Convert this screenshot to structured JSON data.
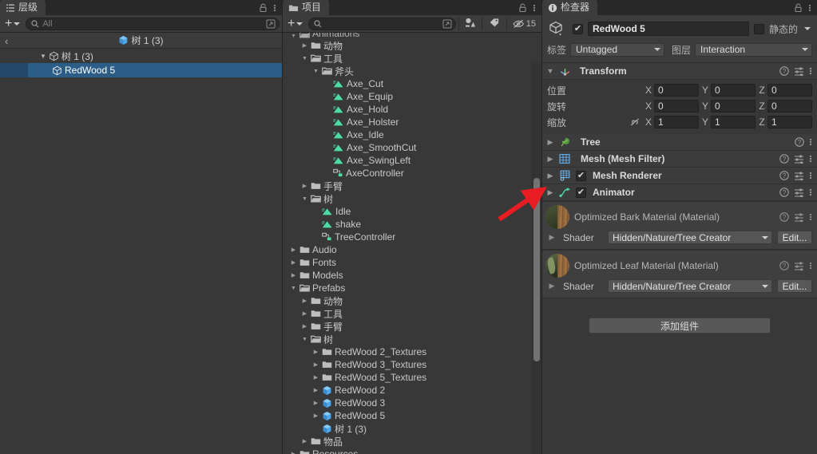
{
  "hierarchy": {
    "tab_label": "层级",
    "tab_icon": "hierarchy-icon",
    "lock_icon": "lock-icon",
    "menu_icon": "kebab-menu-icon",
    "add_label": "+",
    "search_placeholder": "All",
    "breadcrumb": {
      "back": "‹",
      "label": "树 1 (3)"
    },
    "rows": [
      {
        "label": "树 1 (3)",
        "depth": 1,
        "arrow": "▼",
        "icon": "prefab-outline-icon",
        "selected": false
      },
      {
        "label": "RedWood 5",
        "depth": 2,
        "arrow": "",
        "icon": "prefab-outline-icon",
        "selected": true
      }
    ]
  },
  "project": {
    "tab_label": "项目",
    "tab_icon": "folder-icon",
    "lock_icon": "lock-icon",
    "menu_icon": "kebab-menu-icon",
    "add_label": "+",
    "search_placeholder": "",
    "filter_type_icon": "type-filter-icon",
    "filter_label_icon": "label-filter-icon",
    "hidden_count": "15",
    "rows": [
      {
        "label": "Animations",
        "depth": 1,
        "arrow": "▼",
        "icon": "folder-open",
        "clipped": true
      },
      {
        "label": "动物",
        "depth": 2,
        "arrow": "▶",
        "icon": "folder"
      },
      {
        "label": "工具",
        "depth": 2,
        "arrow": "▼",
        "icon": "folder-open"
      },
      {
        "label": "斧头",
        "depth": 3,
        "arrow": "▼",
        "icon": "folder-open"
      },
      {
        "label": "Axe_Cut",
        "depth": 4,
        "arrow": "",
        "icon": "animation-clip"
      },
      {
        "label": "Axe_Equip",
        "depth": 4,
        "arrow": "",
        "icon": "animation-clip"
      },
      {
        "label": "Axe_Hold",
        "depth": 4,
        "arrow": "",
        "icon": "animation-clip"
      },
      {
        "label": "Axe_Holster",
        "depth": 4,
        "arrow": "",
        "icon": "animation-clip"
      },
      {
        "label": "Axe_Idle",
        "depth": 4,
        "arrow": "",
        "icon": "animation-clip"
      },
      {
        "label": "Axe_SmoothCut",
        "depth": 4,
        "arrow": "",
        "icon": "animation-clip"
      },
      {
        "label": "Axe_SwingLeft",
        "depth": 4,
        "arrow": "",
        "icon": "animation-clip"
      },
      {
        "label": "AxeController",
        "depth": 4,
        "arrow": "",
        "icon": "animator-controller"
      },
      {
        "label": "手臂",
        "depth": 2,
        "arrow": "▶",
        "icon": "folder"
      },
      {
        "label": "树",
        "depth": 2,
        "arrow": "▼",
        "icon": "folder-open"
      },
      {
        "label": "Idle",
        "depth": 3,
        "arrow": "",
        "icon": "animation-clip"
      },
      {
        "label": "shake",
        "depth": 3,
        "arrow": "",
        "icon": "animation-clip"
      },
      {
        "label": "TreeController",
        "depth": 3,
        "arrow": "",
        "icon": "animator-controller"
      },
      {
        "label": "Audio",
        "depth": 1,
        "arrow": "▶",
        "icon": "folder"
      },
      {
        "label": "Fonts",
        "depth": 1,
        "arrow": "▶",
        "icon": "folder"
      },
      {
        "label": "Models",
        "depth": 1,
        "arrow": "▶",
        "icon": "folder"
      },
      {
        "label": "Prefabs",
        "depth": 1,
        "arrow": "▼",
        "icon": "folder-open"
      },
      {
        "label": "动物",
        "depth": 2,
        "arrow": "▶",
        "icon": "folder"
      },
      {
        "label": "工具",
        "depth": 2,
        "arrow": "▶",
        "icon": "folder"
      },
      {
        "label": "手臂",
        "depth": 2,
        "arrow": "▶",
        "icon": "folder"
      },
      {
        "label": "树",
        "depth": 2,
        "arrow": "▼",
        "icon": "folder-open"
      },
      {
        "label": "RedWood 2_Textures",
        "depth": 3,
        "arrow": "▶",
        "icon": "folder"
      },
      {
        "label": "RedWood 3_Textures",
        "depth": 3,
        "arrow": "▶",
        "icon": "folder"
      },
      {
        "label": "RedWood 5_Textures",
        "depth": 3,
        "arrow": "▶",
        "icon": "folder"
      },
      {
        "label": "RedWood 2",
        "depth": 3,
        "arrow": "▶",
        "icon": "prefab"
      },
      {
        "label": "RedWood 3",
        "depth": 3,
        "arrow": "▶",
        "icon": "prefab"
      },
      {
        "label": "RedWood 5",
        "depth": 3,
        "arrow": "▶",
        "icon": "prefab"
      },
      {
        "label": "树 1 (3)",
        "depth": 3,
        "arrow": "",
        "icon": "prefab"
      },
      {
        "label": "物品",
        "depth": 2,
        "arrow": "▶",
        "icon": "folder"
      },
      {
        "label": "Resources",
        "depth": 1,
        "arrow": "▶",
        "icon": "folder"
      }
    ]
  },
  "inspector": {
    "tab_label": "检查器",
    "tab_icon": "info-icon",
    "lock_icon": "lock-icon",
    "menu_icon": "kebab-menu-icon",
    "object": {
      "enabled": true,
      "icon": "gameobject-cube-icon",
      "name": "RedWood 5",
      "static_label": "静态的",
      "static_checked": false,
      "tag_label": "标签",
      "tag_value": "Untagged",
      "layer_label": "图层",
      "layer_value": "Interaction"
    },
    "transform": {
      "title": "Transform",
      "icon": "transform-axes-icon",
      "help_icon": "help-icon",
      "preset_icon": "preset-icon",
      "menu_icon": "kebab-menu-icon",
      "rows": [
        {
          "label": "位置",
          "link": false,
          "x": "0",
          "y": "0",
          "z": "0"
        },
        {
          "label": "旋转",
          "link": false,
          "x": "0",
          "y": "0",
          "z": "0"
        },
        {
          "label": "缩放",
          "link": true,
          "link_icon": "link-broken-icon",
          "x": "1",
          "y": "1",
          "z": "1"
        }
      ],
      "axis_labels": [
        "X",
        "Y",
        "Z"
      ]
    },
    "components": [
      {
        "title": "Tree",
        "icon": "tree-leaf-icon",
        "has_checkbox": false,
        "checked": false,
        "has_preset": false
      },
      {
        "title": "Mesh (Mesh Filter)",
        "icon": "mesh-filter-icon",
        "has_checkbox": false,
        "checked": false,
        "has_preset": true
      },
      {
        "title": "Mesh Renderer",
        "icon": "mesh-renderer-icon",
        "has_checkbox": true,
        "checked": true,
        "has_preset": true
      },
      {
        "title": "Animator",
        "icon": "animator-icon",
        "has_checkbox": true,
        "checked": true,
        "has_preset": true
      }
    ],
    "materials": [
      {
        "title": "Optimized Bark Material (Material)",
        "preview": "bark-material-preview",
        "shader_label": "Shader",
        "shader_value": "Hidden/Nature/Tree Creator",
        "edit_label": "Edit..."
      },
      {
        "title": "Optimized Leaf Material (Material)",
        "preview": "leaf-material-preview",
        "shader_label": "Shader",
        "shader_value": "Hidden/Nature/Tree Creator",
        "edit_label": "Edit..."
      }
    ],
    "add_component_label": "添加组件"
  },
  "annotation": {
    "arrow_color": "#e81c23",
    "points_to": "Animator"
  },
  "colors": {
    "panel_bg": "#383838",
    "header_bg": "#3c3c3c",
    "selection_blue": "#2c5d87",
    "accent_green": "#4ddba4",
    "prefab_blue": "#4fa8ea"
  }
}
